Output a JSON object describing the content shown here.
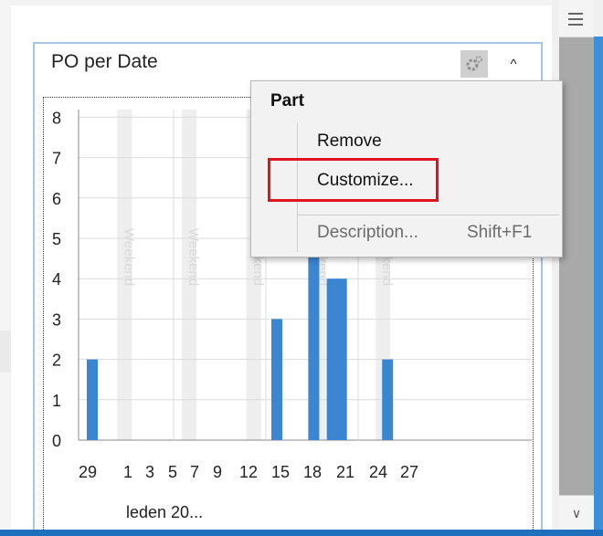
{
  "panel": {
    "title": "PO per Date"
  },
  "context_menu": {
    "header": "Part",
    "items": [
      {
        "label": "Remove",
        "shortcut": "",
        "enabled": true
      },
      {
        "label": "Customize...",
        "shortcut": "",
        "enabled": true,
        "highlighted": true
      },
      {
        "label": "Description...",
        "shortcut": "Shift+F1",
        "enabled": false
      }
    ]
  },
  "colors": {
    "bar": "#3a86d1",
    "highlight": "#e0141e",
    "weekend_band": "#eeeeee",
    "accent": "#3c8fd8"
  },
  "chart_data": {
    "type": "bar",
    "x_tick_labels": [
      "29",
      "1",
      "3",
      "5",
      "7",
      "9",
      "12",
      "15",
      "18",
      "21",
      "24",
      "27"
    ],
    "x_axis_label": "leden 20...",
    "ylim": [
      0,
      8
    ],
    "y_ticks": [
      0,
      1,
      2,
      3,
      4,
      5,
      6,
      7,
      8
    ],
    "grid": true,
    "band_label": "Weekend",
    "weekend_bands": [
      {
        "start": 3,
        "end": 4
      },
      {
        "start": 10,
        "end": 11
      },
      {
        "start": 17,
        "end": 18
      },
      {
        "start": 24,
        "end": 25
      },
      {
        "start": 31,
        "end": 32
      }
    ],
    "bars": [
      {
        "day": 0,
        "value": 2
      },
      {
        "day": 20,
        "value": 3
      },
      {
        "day": 24,
        "value": 5
      },
      {
        "day": 26,
        "value": 4
      },
      {
        "day": 27,
        "value": 4
      },
      {
        "day": 32,
        "value": 2
      }
    ]
  }
}
